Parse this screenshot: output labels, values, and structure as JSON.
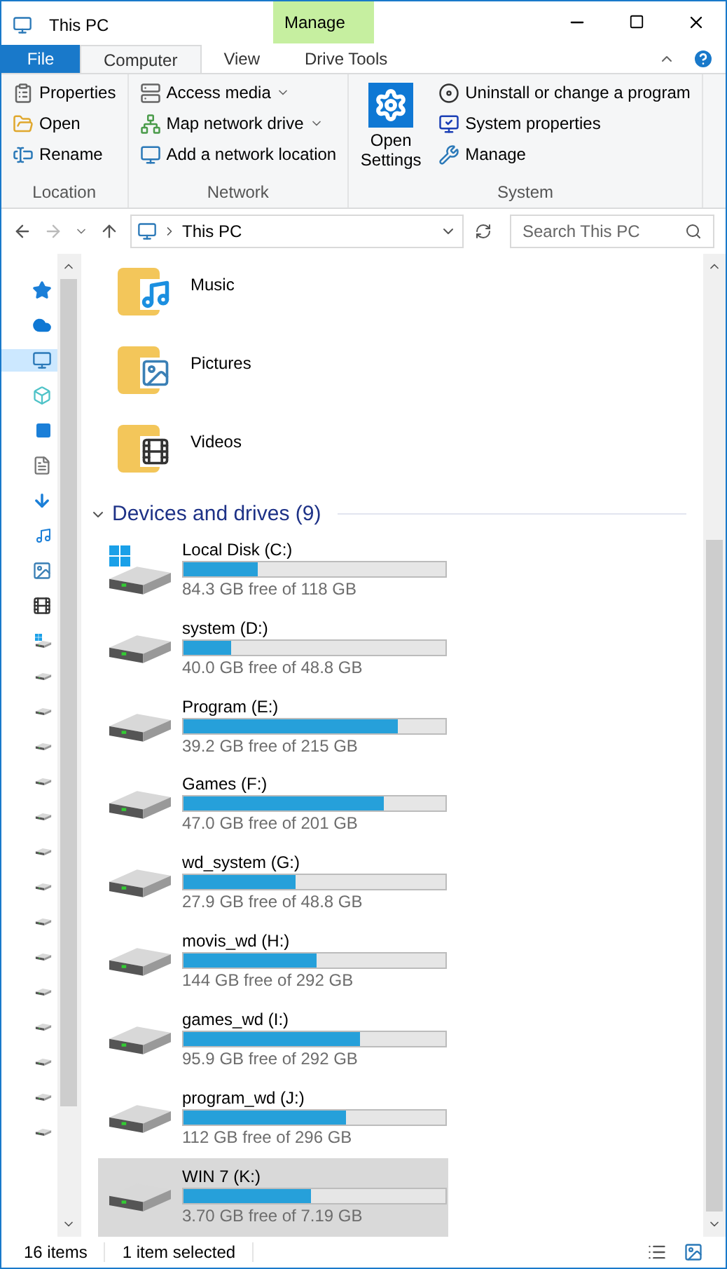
{
  "window": {
    "title": "This PC",
    "context_tab_header": "Manage"
  },
  "file_menu": "File",
  "tabs": [
    {
      "label": "Computer",
      "selected": true
    },
    {
      "label": "View",
      "selected": false
    },
    {
      "label": "Drive Tools",
      "selected": false
    }
  ],
  "ribbon_groups": [
    {
      "name": "Location",
      "commands": [
        {
          "label": "Properties"
        },
        {
          "label": "Open"
        },
        {
          "label": "Rename"
        }
      ]
    },
    {
      "name": "Network",
      "commands": [
        {
          "label": "Access media",
          "dropdown": true
        },
        {
          "label": "Map network drive",
          "dropdown": true
        },
        {
          "label": "Add a network location",
          "dropdown": false
        }
      ]
    },
    {
      "name": "System",
      "large": {
        "label": "Open Settings"
      },
      "commands": [
        {
          "label": "Uninstall or change a program"
        },
        {
          "label": "System properties"
        },
        {
          "label": "Manage"
        }
      ]
    }
  ],
  "address": {
    "location": "This PC",
    "search_placeholder": "Search This PC"
  },
  "nav_items": [
    {
      "kind": "quick",
      "selected": false
    },
    {
      "kind": "cloud",
      "selected": false
    },
    {
      "kind": "pc",
      "selected": true
    },
    {
      "kind": "objects",
      "selected": false
    },
    {
      "kind": "desktop",
      "selected": false
    },
    {
      "kind": "documents",
      "selected": false
    },
    {
      "kind": "downloads",
      "selected": false
    },
    {
      "kind": "music",
      "selected": false
    },
    {
      "kind": "pictures",
      "selected": false
    },
    {
      "kind": "videos",
      "selected": false
    },
    {
      "kind": "windrive",
      "selected": false
    },
    {
      "kind": "drive",
      "selected": false
    },
    {
      "kind": "drive",
      "selected": false
    },
    {
      "kind": "drive",
      "selected": false
    },
    {
      "kind": "drive",
      "selected": false
    },
    {
      "kind": "drive",
      "selected": false
    },
    {
      "kind": "drive",
      "selected": false
    },
    {
      "kind": "drive",
      "selected": false
    },
    {
      "kind": "drive",
      "selected": false
    },
    {
      "kind": "drive",
      "selected": false
    },
    {
      "kind": "drive",
      "selected": false
    },
    {
      "kind": "drive",
      "selected": false
    },
    {
      "kind": "drive",
      "selected": false
    },
    {
      "kind": "drive",
      "selected": false
    },
    {
      "kind": "drive",
      "selected": false
    }
  ],
  "folders": [
    {
      "name": "Music",
      "kind": "music"
    },
    {
      "name": "Pictures",
      "kind": "pictures"
    },
    {
      "name": "Videos",
      "kind": "videos"
    }
  ],
  "devices_section": {
    "title": "Devices and drives (9)",
    "expanded": true
  },
  "drives": [
    {
      "name": "Local Disk (C:)",
      "free": "84.3 GB free of 118 GB",
      "level": 0.286,
      "system": true,
      "selected": false
    },
    {
      "name": "system (D:)",
      "free": "40.0 GB free of 48.8 GB",
      "level": 0.18,
      "system": false,
      "selected": false
    },
    {
      "name": "Program (E:)",
      "free": "39.2 GB free of 215 GB",
      "level": 0.818,
      "system": false,
      "selected": false
    },
    {
      "name": "Games (F:)",
      "free": "47.0 GB free of 201 GB",
      "level": 0.766,
      "system": false,
      "selected": false
    },
    {
      "name": "wd_system (G:)",
      "free": "27.9 GB free of 48.8 GB",
      "level": 0.428,
      "system": false,
      "selected": false
    },
    {
      "name": "movis_wd (H:)",
      "free": "144 GB free of 292 GB",
      "level": 0.507,
      "system": false,
      "selected": false
    },
    {
      "name": "games_wd (I:)",
      "free": "95.9 GB free of 292 GB",
      "level": 0.672,
      "system": false,
      "selected": false
    },
    {
      "name": "program_wd (J:)",
      "free": "112 GB free of 296 GB",
      "level": 0.622,
      "system": false,
      "selected": false
    },
    {
      "name": "WIN 7 (K:)",
      "free": "3.70 GB free of 7.19 GB",
      "level": 0.485,
      "system": false,
      "selected": true
    }
  ],
  "status_bar": {
    "items": "16 items",
    "selection": "1 item selected"
  }
}
